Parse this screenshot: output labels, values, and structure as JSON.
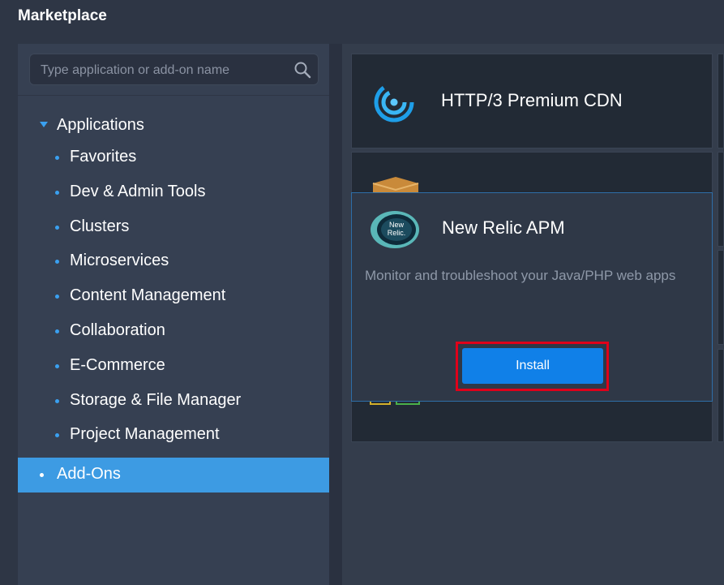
{
  "header": {
    "title": "Marketplace"
  },
  "search": {
    "placeholder": "Type application or add-on name"
  },
  "sidebar": {
    "section": "Applications",
    "items": [
      {
        "label": "Favorites"
      },
      {
        "label": "Dev & Admin Tools"
      },
      {
        "label": "Clusters"
      },
      {
        "label": "Microservices"
      },
      {
        "label": "Content Management"
      },
      {
        "label": "Collaboration"
      },
      {
        "label": "E-Commerce"
      },
      {
        "label": "Storage & File Manager"
      },
      {
        "label": "Project Management"
      }
    ],
    "active": "Add-Ons"
  },
  "cards": [
    {
      "title": "HTTP/3 Premium CDN",
      "icon": "cdn-swirl-icon"
    },
    {
      "title": "",
      "icon": "package-box-icon"
    }
  ],
  "popup": {
    "title": "New Relic APM",
    "logo_text_1": "New",
    "logo_text_2": "Relic.",
    "description": "Monitor and troubleshoot your Java/PHP web apps",
    "install_label": "Install"
  },
  "colors": {
    "accent": "#3d9be3",
    "install": "#1080e8",
    "highlight": "#e0001a"
  }
}
